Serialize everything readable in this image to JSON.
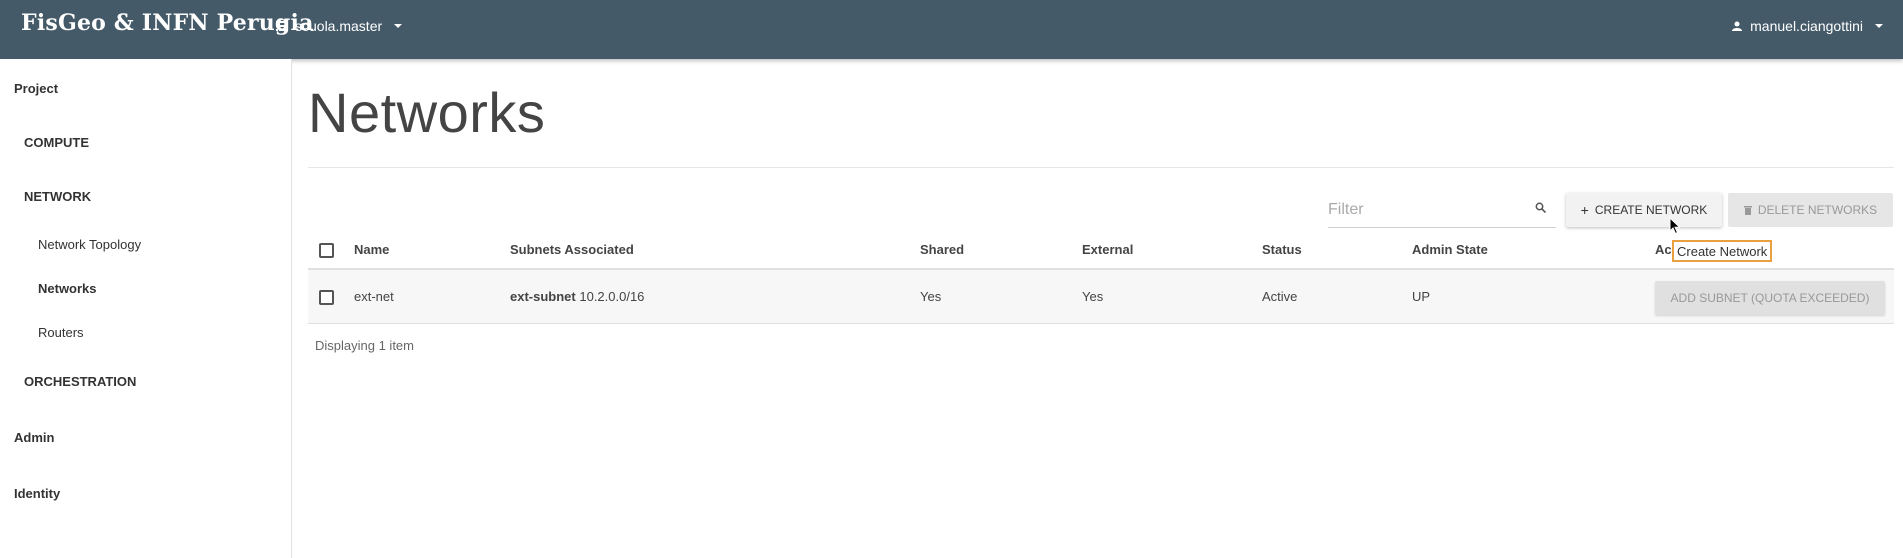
{
  "header": {
    "brand": "FisGeo & INFN Perugia",
    "project": "scuola.master",
    "user": "manuel.ciangottini"
  },
  "sidebar": {
    "project": "Project",
    "compute": "COMPUTE",
    "network": "NETWORK",
    "network_items": [
      "Network Topology",
      "Networks",
      "Routers"
    ],
    "orchestration": "ORCHESTRATION",
    "admin": "Admin",
    "identity": "Identity"
  },
  "page": {
    "title": "Networks"
  },
  "toolbar": {
    "filter_placeholder": "Filter",
    "create_label": "CREATE NETWORK",
    "delete_label": "DELETE NETWORKS"
  },
  "table": {
    "columns": [
      "Name",
      "Subnets Associated",
      "Shared",
      "External",
      "Status",
      "Admin State",
      "Ac"
    ],
    "rows": [
      {
        "name": "ext-net",
        "subnet_name": "ext-subnet",
        "subnet_cidr": "10.2.0.0/16",
        "shared": "Yes",
        "external": "Yes",
        "status": "Active",
        "admin_state": "UP",
        "action": "ADD SUBNET (QUOTA EXCEEDED)"
      }
    ],
    "footer": "Displaying 1 item"
  },
  "tooltip": {
    "text": "Create Network"
  },
  "colors": {
    "topbar": "#455a69",
    "tooltip_border": "#e8a041"
  },
  "icons": {
    "project": "list-icon",
    "user": "user-icon",
    "filter": "search-icon",
    "create": "plus-icon",
    "delete": "trash-icon"
  }
}
